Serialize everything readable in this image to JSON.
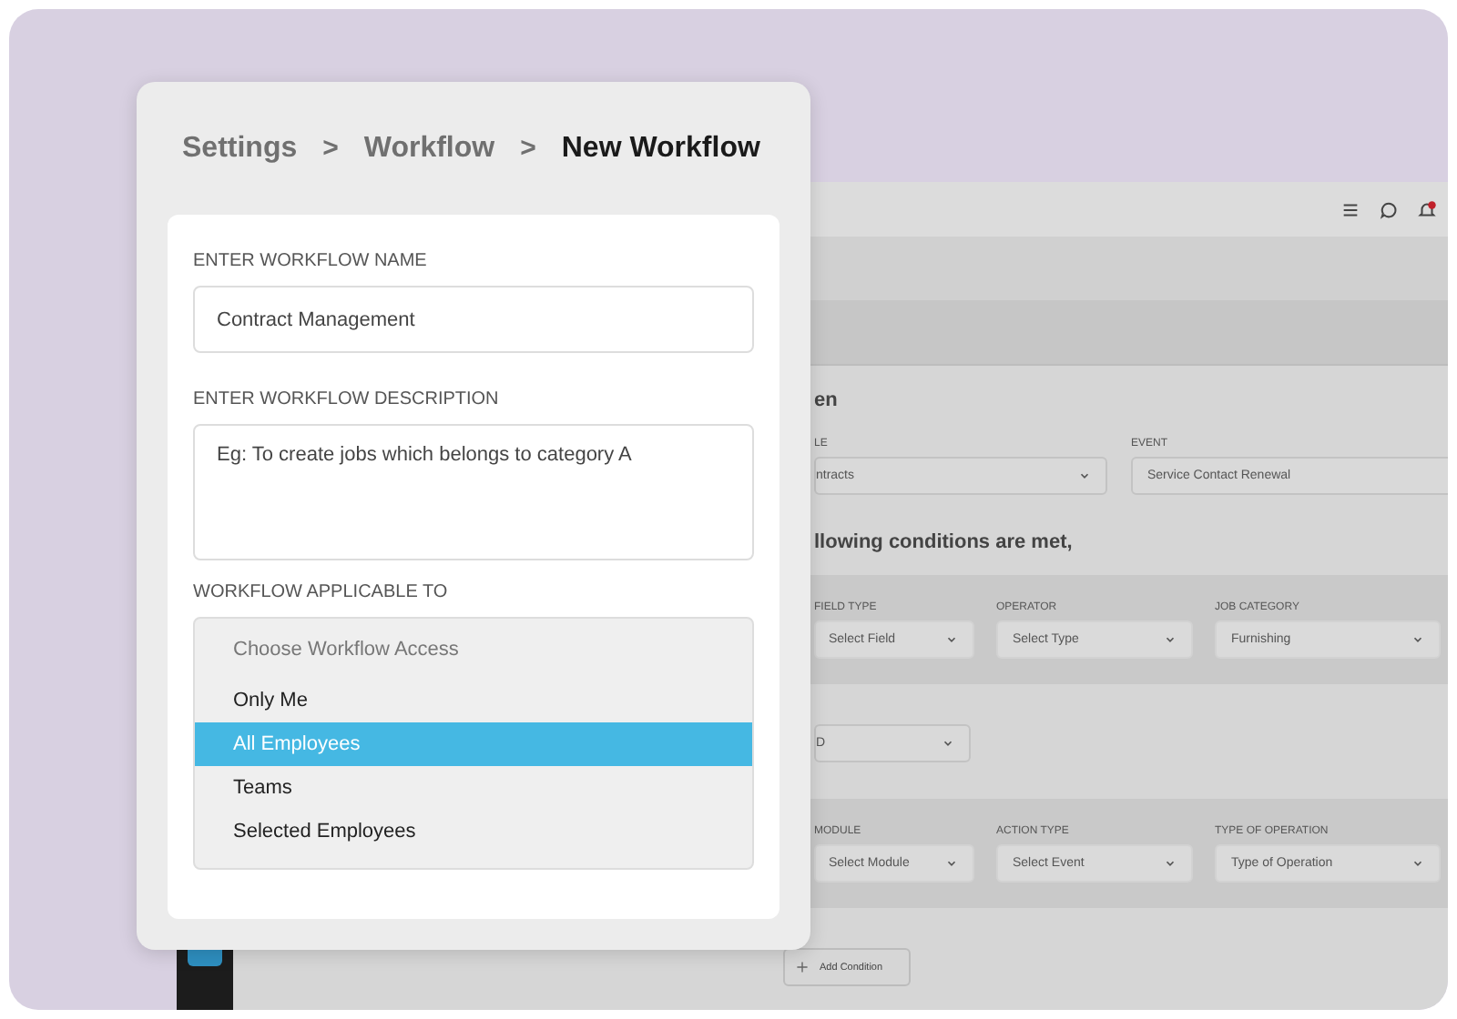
{
  "background_app": {
    "when_heading": "en",
    "trigger_fields": [
      {
        "label": "LE",
        "value": "ntracts",
        "kind": "select"
      },
      {
        "label": "EVENT",
        "value": "Service Contact Renewal",
        "kind": "text"
      }
    ],
    "conditions_heading": "llowing conditions are met,",
    "condition_fields": [
      {
        "label": "FIELD TYPE",
        "value": "Select Field"
      },
      {
        "label": "OPERATOR",
        "value": "Select Type"
      },
      {
        "label": "JOB CATEGORY",
        "value": "Furnishing"
      }
    ],
    "join_select": "D",
    "action_fields": [
      {
        "label": "MODULE",
        "value": "Select Module"
      },
      {
        "label": "ACTION TYPE",
        "value": "Select Event"
      },
      {
        "label": "TYPE OF OPERATION",
        "value": "Type of Operation"
      }
    ],
    "add_button": "Add Condition"
  },
  "breadcrumb": [
    {
      "kind": "crumb",
      "label": "Settings",
      "current": false
    },
    {
      "kind": "separator",
      "label": ">"
    },
    {
      "kind": "crumb",
      "label": "Workflow",
      "current": false
    },
    {
      "kind": "separator",
      "label": ">"
    },
    {
      "kind": "crumb",
      "label": "New Workflow",
      "current": true
    }
  ],
  "form": {
    "name_label": "ENTER WORKFLOW NAME",
    "name_value": "Contract Management",
    "description_label": "ENTER WORKFLOW DESCRIPTION",
    "description_placeholder": "Eg: To create jobs which belongs to category A",
    "access_label": "WORKFLOW APPLICABLE TO",
    "access_list": {
      "header": "Choose Workflow Access",
      "options": [
        {
          "label": "Only Me",
          "selected": false
        },
        {
          "label": "All Employees",
          "selected": true
        },
        {
          "label": "Teams",
          "selected": false
        },
        {
          "label": "Selected Employees",
          "selected": false
        }
      ]
    }
  }
}
